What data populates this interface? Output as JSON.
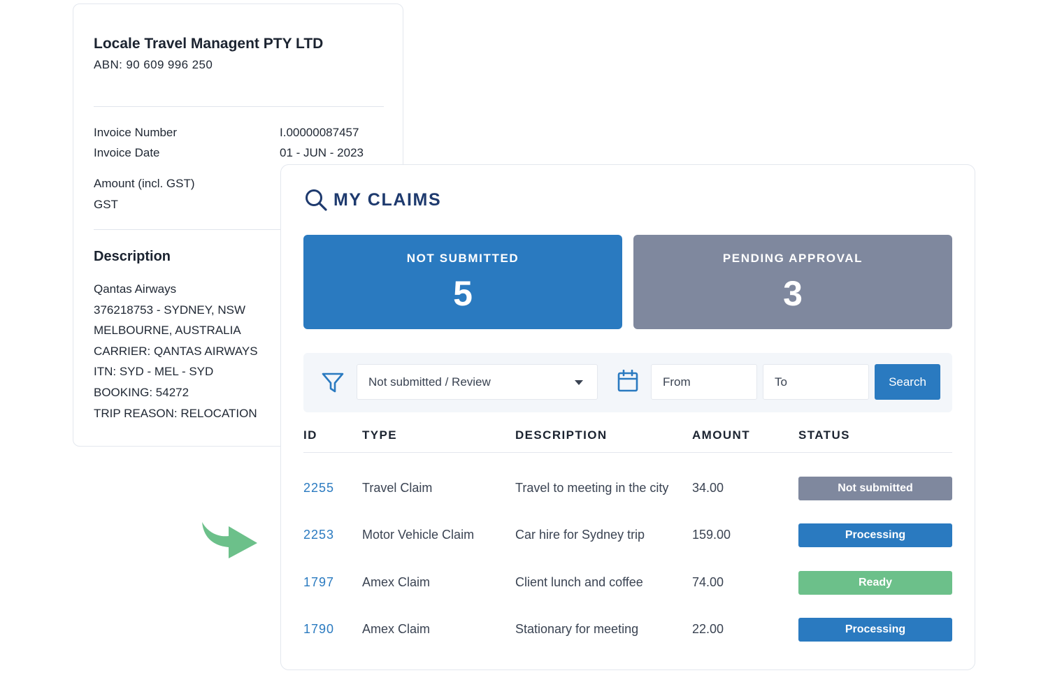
{
  "invoice": {
    "company": "Locale Travel Managent PTY LTD",
    "abn": "ABN: 90 609 996 250",
    "number_label": "Invoice Number",
    "number_value": "I.00000087457",
    "date_label": "Invoice Date",
    "date_value": "01 - JUN  -  2023",
    "amount_label": "Amount (incl. GST)",
    "gst_label": "GST",
    "description_title": "Description",
    "description_lines": [
      "Qantas Airways",
      "376218753 - SYDNEY, NSW",
      "MELBOURNE, AUSTRALIA",
      "CARRIER: QANTAS AIRWAYS",
      "ITN: SYD - MEL - SYD",
      "BOOKING: 54272",
      "TRIP REASON: RELOCATION"
    ]
  },
  "claims": {
    "title": "MY CLAIMS",
    "stats": [
      {
        "label": "NOT SUBMITTED",
        "count": "5",
        "color": "#2a7ac0"
      },
      {
        "label": "PENDING APPROVAL",
        "count": "3",
        "color": "#7f889e"
      }
    ],
    "filter": {
      "status_value": "Not submitted / Review",
      "from_placeholder": "From",
      "to_placeholder": "To",
      "search_label": "Search"
    },
    "columns": [
      "ID",
      "TYPE",
      "DESCRIPTION",
      "AMOUNT",
      "STATUS"
    ],
    "rows": [
      {
        "id": "2255",
        "type": "Travel Claim",
        "description": "Travel to meeting in the city",
        "amount": "34.00",
        "status": "Not submitted",
        "status_color": "#7f889e"
      },
      {
        "id": "2253",
        "type": "Motor Vehicle Claim",
        "description": "Car hire for Sydney trip",
        "amount": "159.00",
        "status": "Processing",
        "status_color": "#2a7ac0"
      },
      {
        "id": "1797",
        "type": "Amex Claim",
        "description": "Client lunch and coffee",
        "amount": "74.00",
        "status": "Ready",
        "status_color": "#6cc08a"
      },
      {
        "id": "1790",
        "type": "Amex Claim",
        "description": "Stationary for meeting",
        "amount": "22.00",
        "status": "Processing",
        "status_color": "#2a7ac0"
      }
    ]
  },
  "icons": {
    "search": "search-icon",
    "filter": "filter-icon",
    "calendar": "calendar-icon",
    "arrow": "curved-arrow-icon"
  },
  "colors": {
    "primary": "#2a7ac0",
    "muted": "#7f889e",
    "success": "#6cc08a",
    "title": "#1e3a6e"
  }
}
